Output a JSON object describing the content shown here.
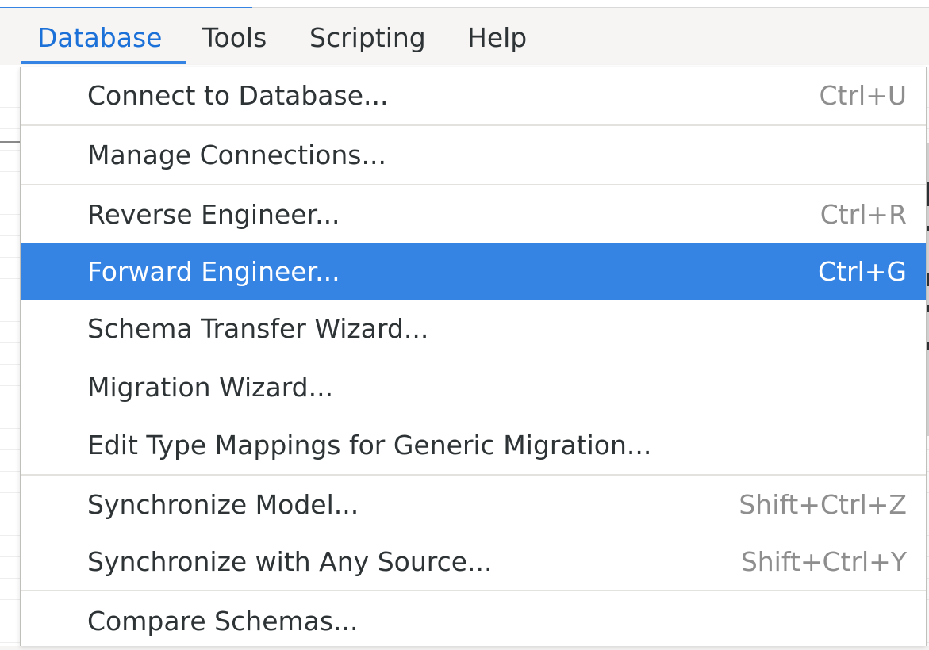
{
  "menubar": {
    "items": [
      {
        "label": "Database",
        "active": true
      },
      {
        "label": "Tools"
      },
      {
        "label": "Scripting"
      },
      {
        "label": "Help"
      }
    ]
  },
  "database_menu": {
    "items": [
      {
        "label": "Connect to Database...",
        "shortcut": "Ctrl+U"
      },
      {
        "label": "Manage Connections...",
        "shortcut": ""
      },
      {
        "label": "Reverse Engineer...",
        "shortcut": "Ctrl+R"
      },
      {
        "label": "Forward Engineer...",
        "shortcut": "Ctrl+G",
        "highlighted": true
      },
      {
        "label": "Schema Transfer Wizard...",
        "shortcut": ""
      },
      {
        "label": "Migration Wizard...",
        "shortcut": ""
      },
      {
        "label": "Edit Type Mappings for Generic Migration...",
        "shortcut": ""
      },
      {
        "label": "Synchronize Model...",
        "shortcut": "Shift+Ctrl+Z"
      },
      {
        "label": "Synchronize with Any Source...",
        "shortcut": "Shift+Ctrl+Y"
      },
      {
        "label": "Compare Schemas...",
        "shortcut": ""
      }
    ]
  },
  "colors": {
    "accent": "#3584e4",
    "active_menubar_text": "#1c71d8",
    "menu_text": "#2e3436",
    "shortcut_text": "#8e8e8e",
    "highlight_text": "#ffffff"
  }
}
